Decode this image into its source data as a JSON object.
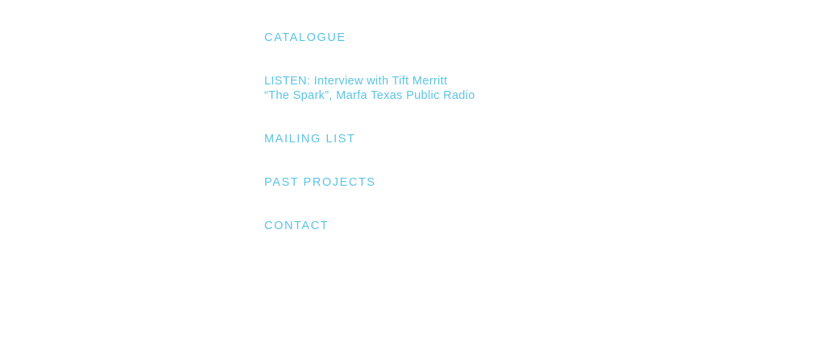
{
  "nav": {
    "catalogue": "CATALOGUE",
    "listen": {
      "line1": "LISTEN:  Interview with Tift Merritt",
      "line2": "“The Spark”, Marfa Texas Public Radio"
    },
    "mailing_list": "MAILING LIST",
    "past_projects": "PAST PROJECTS",
    "contact": "CONTACT"
  },
  "colors": {
    "link": "#5bc4e6",
    "background": "#ffffff"
  }
}
